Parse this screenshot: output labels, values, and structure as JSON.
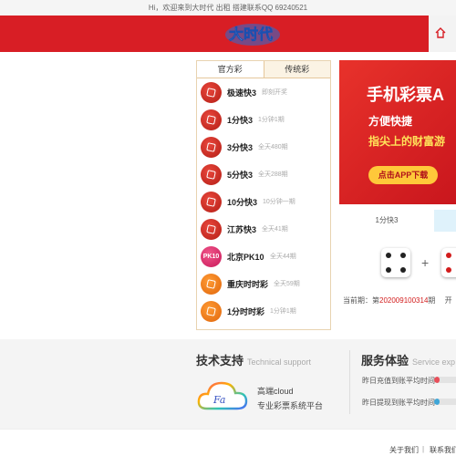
{
  "topbar": {
    "welcome": "Hi，欢迎来到大时代 出租 搭建联系QQ 69240521"
  },
  "header": {
    "logo_text": "大时代",
    "brand_color": "#d81e25"
  },
  "lottery_panel": {
    "tabs": [
      {
        "label": "官方彩",
        "active": true
      },
      {
        "label": "传统彩",
        "active": false
      }
    ],
    "items": [
      {
        "name": "极速快3",
        "desc": "即刻开奖",
        "icon": "dice-icon",
        "color": "red"
      },
      {
        "name": "1分快3",
        "desc": "1分钟1期",
        "icon": "dice-icon",
        "color": "red"
      },
      {
        "name": "3分快3",
        "desc": "全天480期",
        "icon": "dice-icon",
        "color": "red"
      },
      {
        "name": "5分快3",
        "desc": "全天288期",
        "icon": "dice-icon",
        "color": "red"
      },
      {
        "name": "10分快3",
        "desc": "10分钟一期",
        "icon": "dice-icon",
        "color": "red"
      },
      {
        "name": "江苏快3",
        "desc": "全天41期",
        "icon": "dice-icon",
        "color": "red"
      },
      {
        "name": "北京PK10",
        "desc": "全天44期",
        "icon": "pk10-icon",
        "color": "pink",
        "icon_text": "PK10"
      },
      {
        "name": "重庆时时彩",
        "desc": "全天59期",
        "icon": "ssc-icon",
        "color": "orange"
      },
      {
        "name": "1分时时彩",
        "desc": "1分钟1期",
        "icon": "ssc-icon",
        "color": "orange"
      }
    ]
  },
  "banner": {
    "title": "手机彩票A",
    "sub1": "方便快捷",
    "sub2": "指尖上的财富游",
    "button": "点击APP下载"
  },
  "draw_panel": {
    "tab_label": "1分快3",
    "plus": "+",
    "period_label": "当前期：第",
    "period_number": "202009100314",
    "period_suffix": "期",
    "period_extra": "开"
  },
  "support": {
    "title": "技术支持",
    "title_en": "Technical support",
    "cloud_logo_text": "Fa",
    "cloud_name": "高端cloud",
    "cloud_slogan": "专业彩票系统平台"
  },
  "service": {
    "title": "服务体验",
    "title_en": "Service exp",
    "metrics": [
      {
        "label": "昨日充值到账平均时间",
        "fill": 0.15,
        "color": "#e84f5a"
      },
      {
        "label": "昨日提现到账平均时间",
        "fill": 0.15,
        "color": "#3fa6d8"
      }
    ]
  },
  "footer": {
    "links": [
      "关于我们",
      "联系我们"
    ],
    "separator": "|"
  }
}
